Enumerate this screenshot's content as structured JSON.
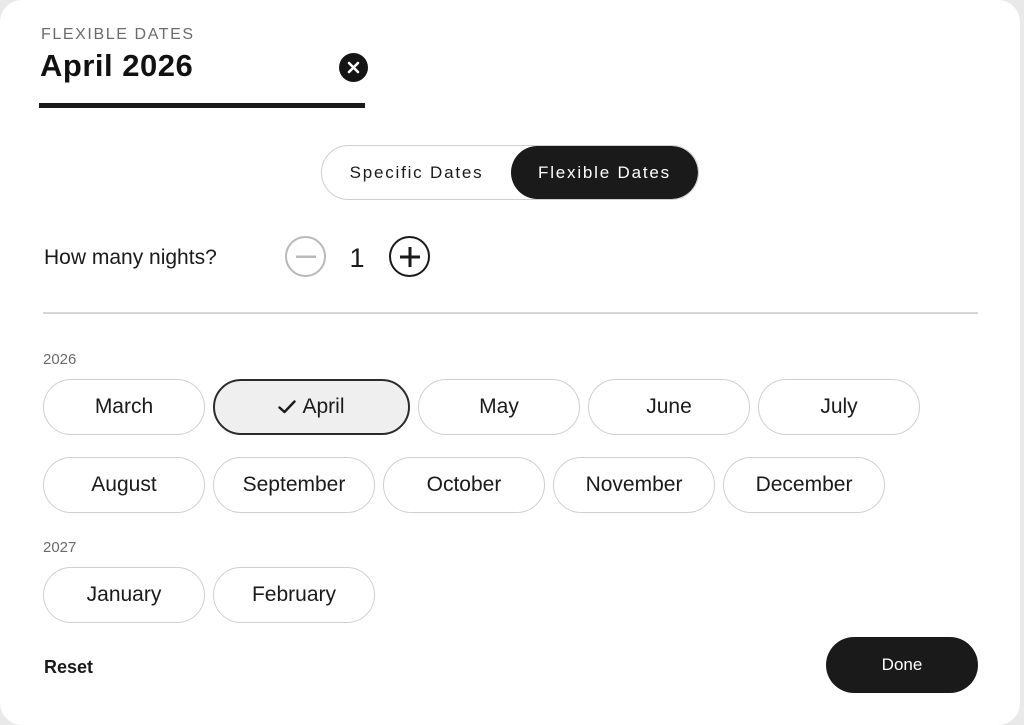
{
  "field": {
    "label": "FLEXIBLE DATES",
    "value": "April 2026",
    "clear_icon": "close-circle-icon"
  },
  "mode_toggle": {
    "options": [
      "Specific Dates",
      "Flexible Dates"
    ],
    "selected": "Flexible Dates"
  },
  "nights": {
    "label": "How many nights?",
    "value": "1",
    "decrement_icon": "minus-icon",
    "increment_icon": "plus-icon",
    "decrement_disabled": true
  },
  "years": [
    {
      "year": "2026",
      "months": [
        "March",
        "April",
        "May",
        "June",
        "July",
        "August",
        "September",
        "October",
        "November",
        "December"
      ]
    },
    {
      "year": "2027",
      "months": [
        "January",
        "February"
      ]
    }
  ],
  "selected_month": "April",
  "selected_icon": "checkmark-icon",
  "footer": {
    "reset_label": "Reset",
    "done_label": "Done"
  },
  "colors": {
    "accent": "#1a1a1a",
    "selected_bg": "#efefef",
    "border": "#cfcfcf"
  }
}
